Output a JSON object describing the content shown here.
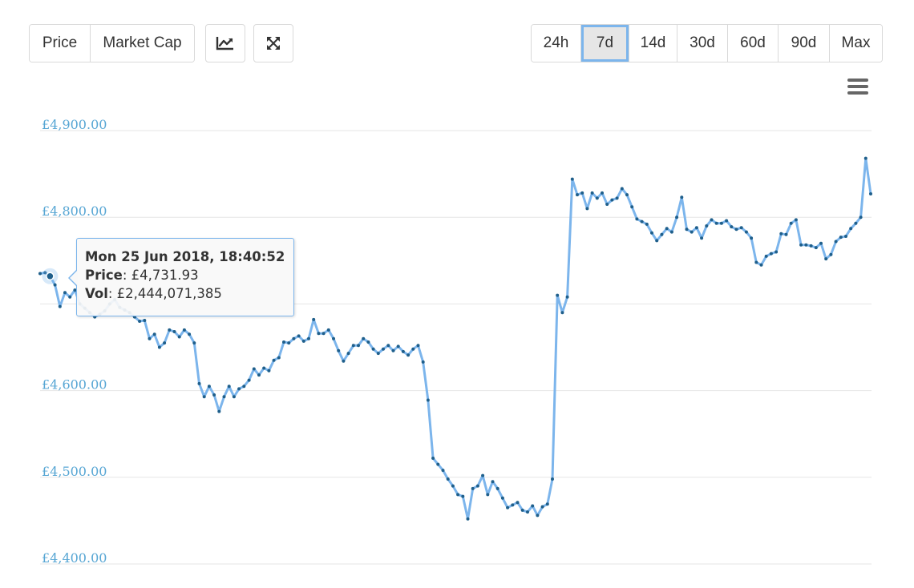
{
  "toolbar": {
    "type_buttons": [
      {
        "label": "Price",
        "active": true
      },
      {
        "label": "Market Cap",
        "active": false
      }
    ],
    "icons": [
      "line-chart-icon",
      "expand-icon"
    ],
    "range_buttons": [
      {
        "label": "24h",
        "active": false
      },
      {
        "label": "7d",
        "active": true
      },
      {
        "label": "14d",
        "active": false
      },
      {
        "label": "30d",
        "active": false
      },
      {
        "label": "60d",
        "active": false
      },
      {
        "label": "90d",
        "active": false
      },
      {
        "label": "Max",
        "active": false
      }
    ],
    "menu_icon": "hamburger-menu-icon"
  },
  "tooltip": {
    "title": "Mon 25 Jun 2018, 18:40:52",
    "price_label": "Price",
    "price_value": "£4,731.93",
    "vol_label": "Vol",
    "vol_value": "£2,444,071,385"
  },
  "colors": {
    "line": "#7cb5ec",
    "marker": "#1f5f8b",
    "axis_text": "#57a6d4",
    "grid": "#e6e6e6",
    "active_border": "#7cb5ec"
  },
  "chart_data": {
    "type": "line",
    "title": "",
    "xlabel": "",
    "ylabel": "",
    "ylim": [
      4400,
      4900
    ],
    "yticks": [
      4400,
      4500,
      4600,
      4700,
      4800,
      4900
    ],
    "ytick_labels": [
      "£4,400.00",
      "£4,500.00",
      "£4,600.00",
      "",
      "£4,800.00",
      "£4,900.00"
    ],
    "grid": true,
    "legend": "none",
    "highlighted_index": 2,
    "series": [
      {
        "values": [
          4735,
          4736,
          4732,
          4722,
          4697,
          4713,
          4708,
          4716,
          4700,
          4695,
          4690,
          4685,
          4688,
          4692,
          4700,
          4705,
          4696,
          4693,
          4690,
          4685,
          4680,
          4681,
          4660,
          4665,
          4650,
          4655,
          4670,
          4668,
          4662,
          4670,
          4665,
          4655,
          4608,
          4593,
          4605,
          4595,
          4576,
          4593,
          4605,
          4593,
          4602,
          4605,
          4612,
          4625,
          4618,
          4626,
          4623,
          4635,
          4638,
          4656,
          4655,
          4660,
          4663,
          4657,
          4660,
          4682,
          4666,
          4666,
          4670,
          4660,
          4646,
          4634,
          4643,
          4652,
          4652,
          4660,
          4656,
          4648,
          4643,
          4648,
          4652,
          4646,
          4651,
          4645,
          4641,
          4648,
          4652,
          4633,
          4589,
          4522,
          4515,
          4508,
          4498,
          4490,
          4480,
          4478,
          4452,
          4487,
          4490,
          4502,
          4480,
          4495,
          4487,
          4476,
          4465,
          4468,
          4471,
          4462,
          4460,
          4467,
          4456,
          4466,
          4469,
          4498,
          4710,
          4690,
          4708,
          4844,
          4826,
          4828,
          4810,
          4828,
          4822,
          4828,
          4815,
          4820,
          4822,
          4833,
          4826,
          4812,
          4798,
          4795,
          4792,
          4782,
          4773,
          4780,
          4787,
          4783,
          4800,
          4823,
          4786,
          4783,
          4788,
          4776,
          4790,
          4797,
          4793,
          4793,
          4796,
          4789,
          4786,
          4788,
          4783,
          4776,
          4748,
          4745,
          4755,
          4758,
          4760,
          4781,
          4780,
          4793,
          4797,
          4768,
          4768,
          4767,
          4765,
          4770,
          4752,
          4757,
          4772,
          4777,
          4778,
          4787,
          4793,
          4800,
          4868,
          4827
        ]
      }
    ]
  }
}
